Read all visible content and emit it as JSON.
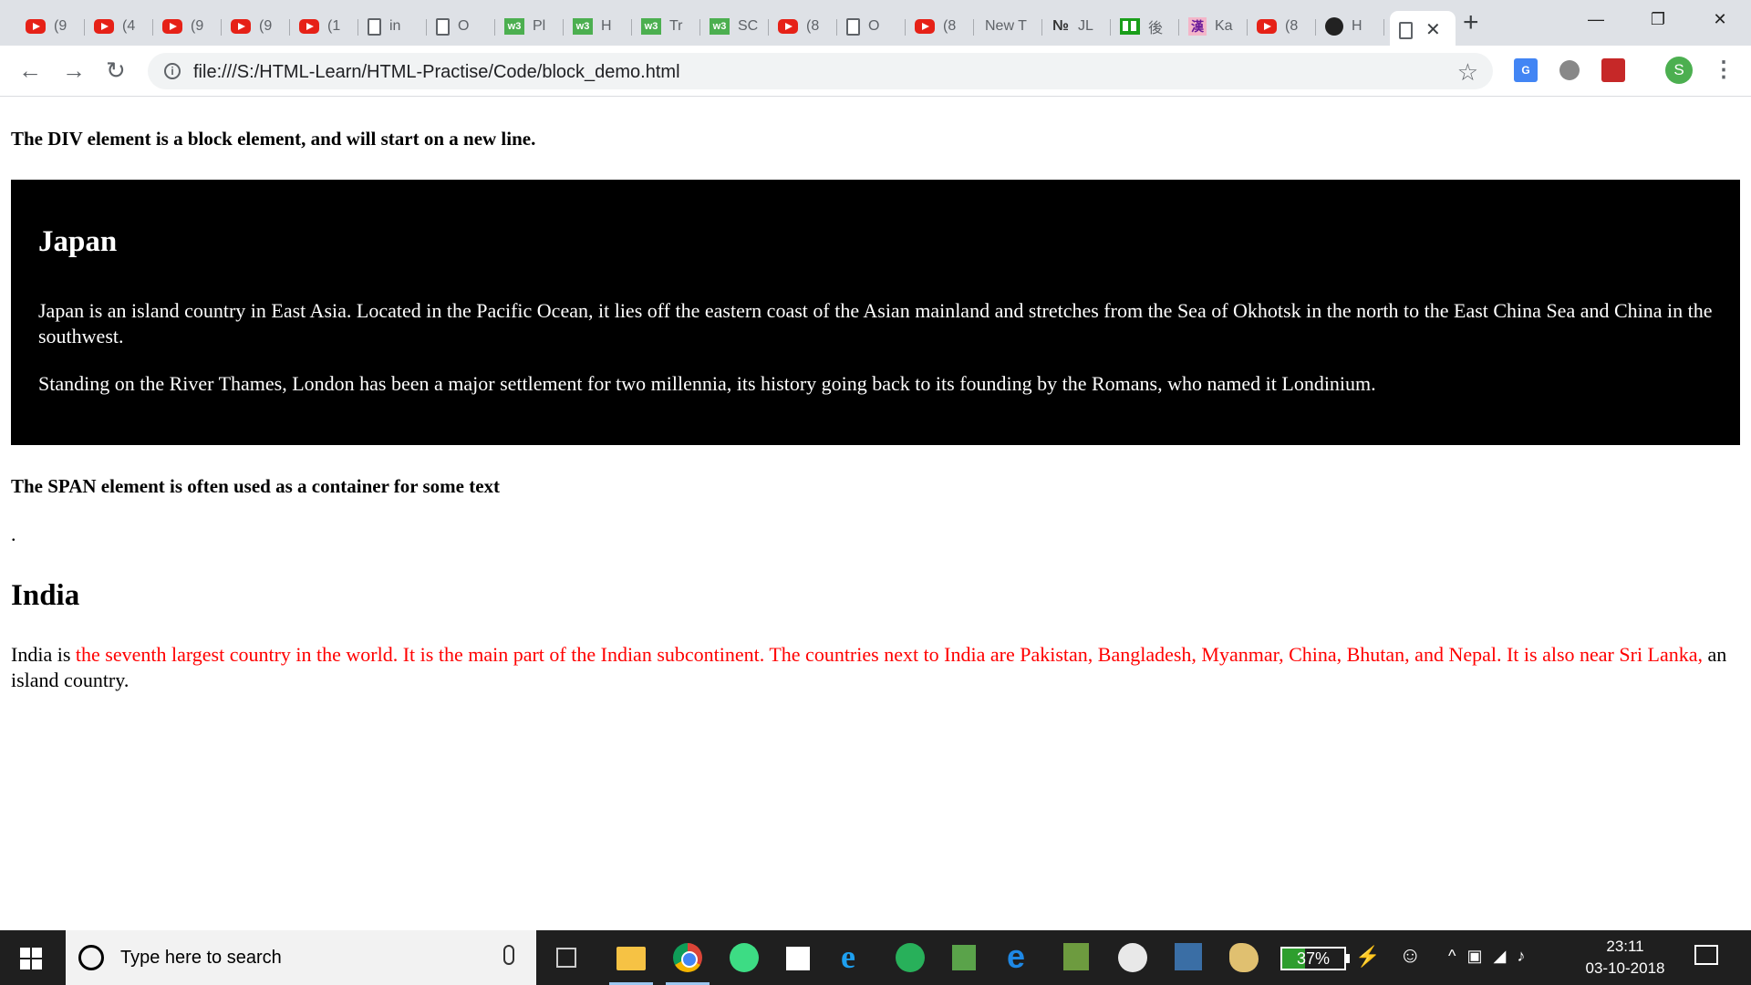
{
  "browser": {
    "tabs": [
      {
        "icon": "youtube",
        "title": "(9"
      },
      {
        "icon": "youtube",
        "title": "(4"
      },
      {
        "icon": "youtube",
        "title": "(9"
      },
      {
        "icon": "youtube",
        "title": "(9"
      },
      {
        "icon": "youtube",
        "title": "(1"
      },
      {
        "icon": "document",
        "title": "in"
      },
      {
        "icon": "document",
        "title": "O"
      },
      {
        "icon": "w3schools",
        "title": "Pl"
      },
      {
        "icon": "w3schools",
        "title": "H"
      },
      {
        "icon": "w3schools",
        "title": "Tr"
      },
      {
        "icon": "w3schools",
        "title": "SC"
      },
      {
        "icon": "youtube",
        "title": "(8"
      },
      {
        "icon": "document",
        "title": "O"
      },
      {
        "icon": "youtube",
        "title": "(8"
      },
      {
        "icon": "none",
        "title": "New T"
      },
      {
        "icon": "jl",
        "title": "JL"
      },
      {
        "icon": "green-app",
        "title": "後"
      },
      {
        "icon": "kanji",
        "title": "Ka"
      },
      {
        "icon": "youtube",
        "title": "(8"
      },
      {
        "icon": "github",
        "title": "H"
      }
    ],
    "favicon_glyphs": {
      "w3schools": "w3",
      "jl": "№",
      "kanji": "漢"
    },
    "active_tab_close": "✕",
    "new_tab": "+",
    "window_controls": {
      "minimize": "—",
      "maximize": "❐",
      "close": "✕"
    },
    "nav": {
      "back": "←",
      "forward": "→",
      "reload": "↻"
    },
    "info_icon": "i",
    "url": "file:///S:/HTML-Learn/HTML-Practise/Code/block_demo.html",
    "bookmark_star": "☆",
    "extension_translate_label": "G",
    "avatar_initial": "S",
    "menu": "⋮"
  },
  "page": {
    "div_heading": "The DIV element is a block element, and will start on a new line.",
    "japan": {
      "title": "Japan",
      "p1": "Japan is an island country in East Asia. Located in the Pacific Ocean, it lies off the eastern coast of the Asian mainland and stretches from the Sea of Okhotsk in the north to the East China Sea and China in the southwest.",
      "p2": "Standing on the River Thames, London has been a major settlement for two millennia, its history going back to its founding by the Romans, who named it Londinium."
    },
    "span_heading": "The SPAN element is often used as a container for some text",
    "dot": ".",
    "india": {
      "title": "India",
      "text_before": "India is ",
      "text_red": "the seventh largest country in the world. It is the main part of the Indian subcontinent. The countries next to India are Pakistan, Bangladesh, Myanmar, China, Bhutan, and Nepal. It is also near Sri Lanka,",
      "text_after": " an island country."
    },
    "colors": {
      "box_background": "#000000",
      "span_red": "#ff0000"
    }
  },
  "taskbar": {
    "search_placeholder": "Type here to search",
    "battery_percent": 37,
    "battery_label": "37%",
    "plug_icon": "⚡",
    "people_icon": "☺",
    "tray": [
      "^",
      "▣",
      "◢",
      "♪"
    ],
    "time": "23:11",
    "date": "03-10-2018"
  }
}
